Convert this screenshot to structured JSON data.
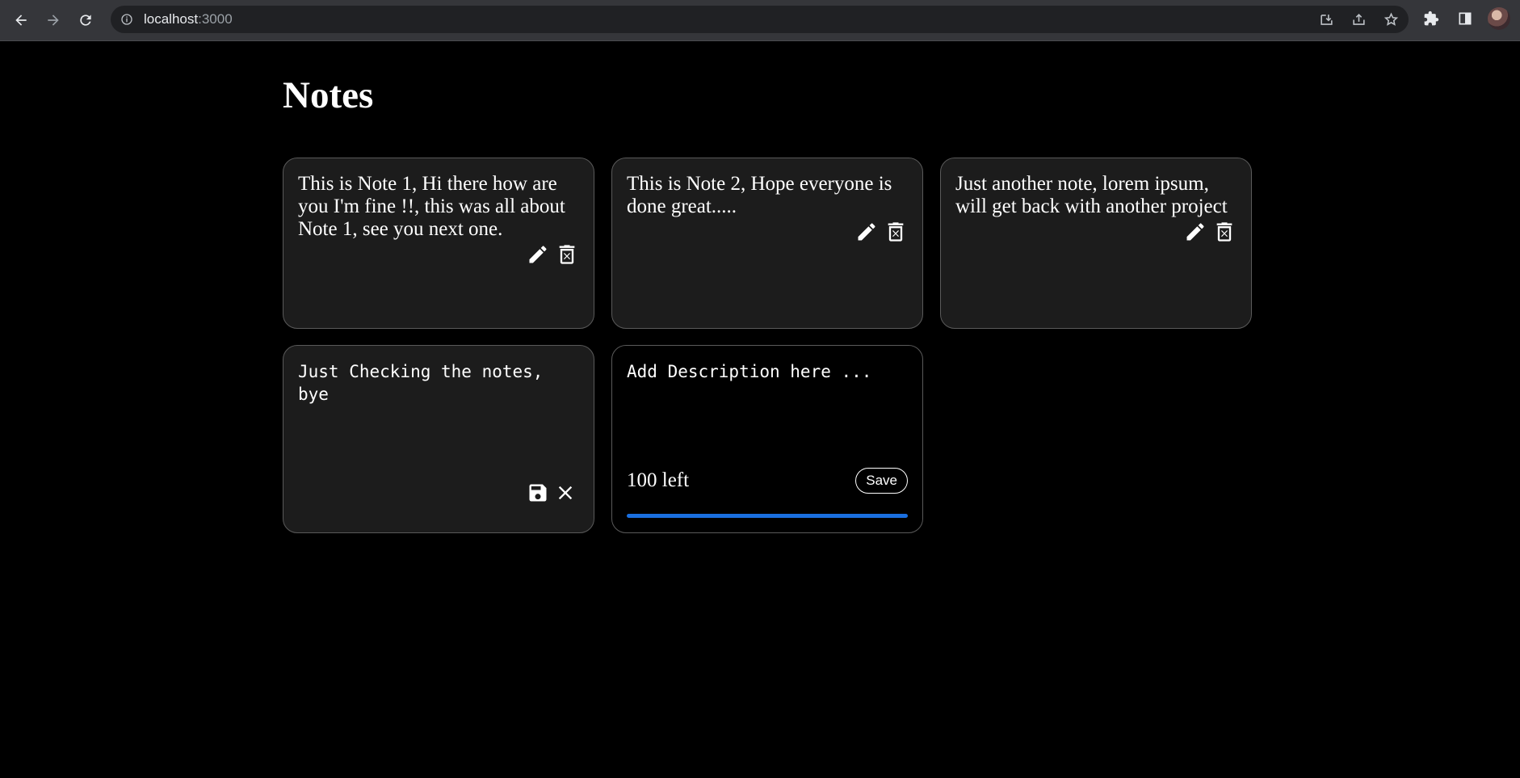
{
  "browser": {
    "url_host": "localhost",
    "url_port": ":3000"
  },
  "page": {
    "title": "Notes"
  },
  "notes": [
    {
      "text": "This is Note 1, Hi there how are you I'm fine !!, this was all about Note 1, see you next one."
    },
    {
      "text": "This is Note 2, Hope everyone is done great....."
    },
    {
      "text": "Just another note, lorem ipsum, will get back with another project"
    }
  ],
  "editing_note": {
    "value": "Just Checking the notes, bye"
  },
  "new_note": {
    "placeholder": "Add Description here ...",
    "remaining_label": "100 left",
    "save_label": "Save",
    "progress_fraction": 1.0,
    "progress_color": "#1a6fe0"
  },
  "icons": {
    "edit": "pencil-icon",
    "delete": "trash-icon",
    "save": "floppy-disk-icon",
    "cancel": "close-icon"
  }
}
